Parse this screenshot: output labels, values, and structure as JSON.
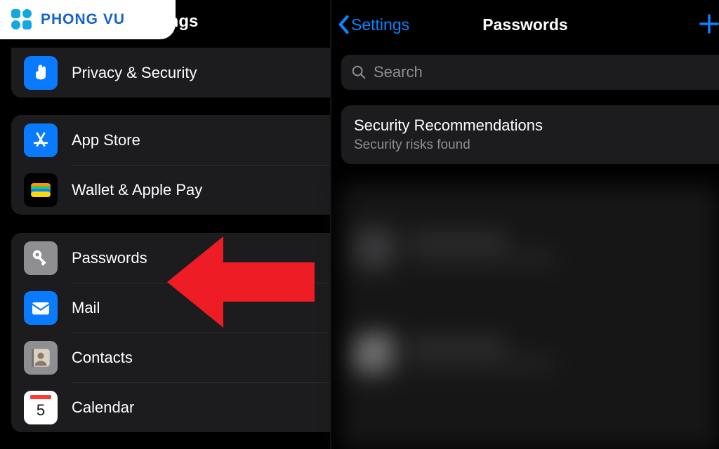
{
  "logo": {
    "text": "PHONG VU"
  },
  "left": {
    "header_title": "Settings",
    "items": {
      "privacy": "Privacy & Security",
      "appstore": "App Store",
      "wallet": "Wallet & Apple Pay",
      "passwords": "Passwords",
      "mail": "Mail",
      "contacts": "Contacts",
      "calendar": "Calendar"
    }
  },
  "right": {
    "back_label": "Settings",
    "title": "Passwords",
    "search_placeholder": "Search",
    "security_recommendations": {
      "title": "Security Recommendations",
      "subtitle": "Security risks found"
    }
  }
}
